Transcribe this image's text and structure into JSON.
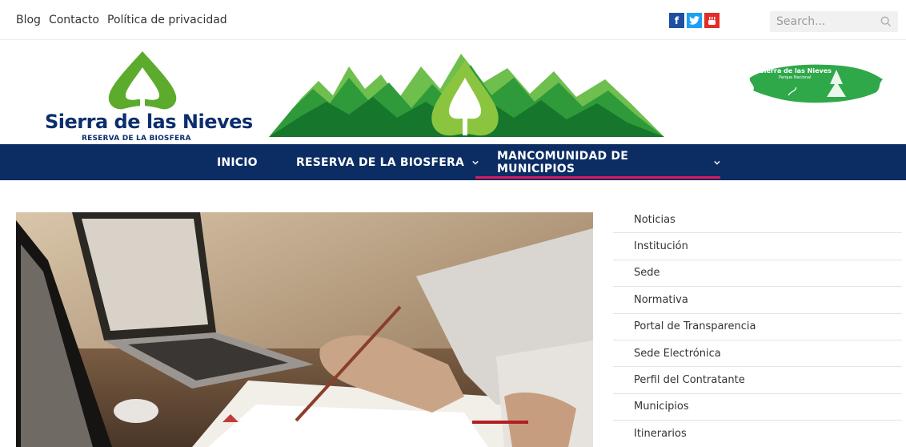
{
  "top_links": [
    "Blog",
    "Contacto",
    "Política de privacidad"
  ],
  "social": {
    "facebook": {
      "icon": "facebook-icon",
      "glyph": "f",
      "color": "#1f4fa0"
    },
    "twitter": {
      "icon": "twitter-icon",
      "glyph": "t",
      "color": "#1da1f2"
    },
    "youtube": {
      "icon": "youtube-icon",
      "glyph": "▶",
      "color": "#e52d27"
    }
  },
  "search": {
    "placeholder": "Search..."
  },
  "logo_left": {
    "title": "Sierra de las Nieves",
    "subtitle": "RESERVA DE LA BIOSFERA"
  },
  "logo_right": {
    "line1": "Sierra de las Nieves",
    "line2": "Parque Nacional"
  },
  "nav": {
    "items": [
      {
        "label": "INICIO",
        "has_dropdown": false
      },
      {
        "label": "RESERVA DE LA BIOSFERA",
        "has_dropdown": true
      },
      {
        "label": "MANCOMUNIDAD DE MUNICIPIOS",
        "has_dropdown": true,
        "active": true
      }
    ]
  },
  "sidebar": {
    "items": [
      "Noticias",
      "Institución",
      "Sede",
      "Normativa",
      "Portal de Transparencia",
      "Sede Electrónica",
      "Perfil del Contratante",
      "Municipios",
      "Itinerarios"
    ]
  },
  "colors": {
    "nav_bg": "#0c2d63",
    "nav_active": "#d81b60",
    "brand_green": "#2e9a2b",
    "brand_blue": "#0b2e6e"
  }
}
